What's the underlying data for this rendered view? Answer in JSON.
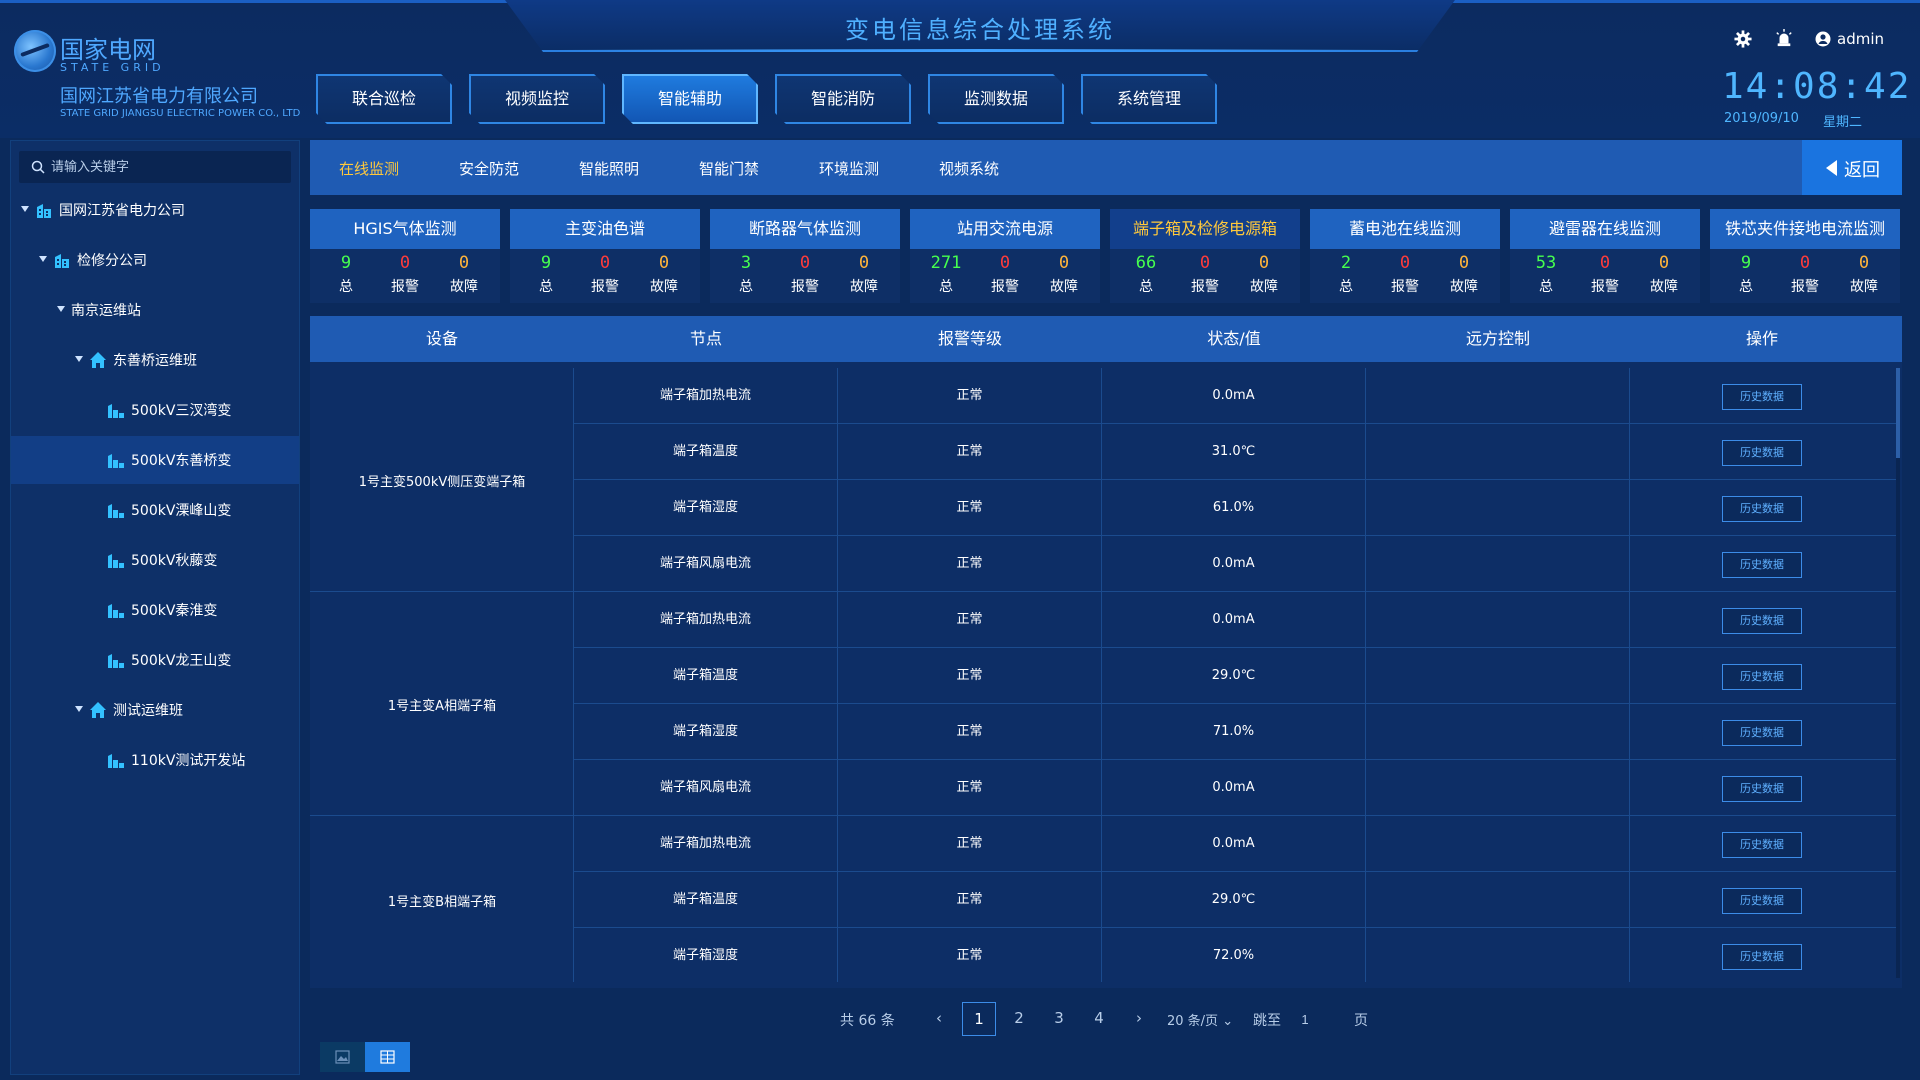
{
  "app": {
    "title": "变电信息综合处理系统"
  },
  "brand": {
    "name_cn": "国家电网",
    "name_en": "STATE GRID",
    "company_cn": "国网江苏省电力有限公司",
    "company_en": "STATE GRID JIANGSU ELECTRIC POWER CO., LTD"
  },
  "main_nav": [
    {
      "label": "联合巡检",
      "active": false
    },
    {
      "label": "视频监控",
      "active": false
    },
    {
      "label": "智能辅助",
      "active": true
    },
    {
      "label": "智能消防",
      "active": false
    },
    {
      "label": "监测数据",
      "active": false
    },
    {
      "label": "系统管理",
      "active": false
    }
  ],
  "user": {
    "name": "admin"
  },
  "clock": {
    "time": "14:08:42",
    "date": "2019/09/10",
    "weekday": "星期二"
  },
  "search": {
    "placeholder": "请输入关键字"
  },
  "tree": [
    {
      "label": "国网江苏省电力公司",
      "level": 0,
      "icon": "building-icon",
      "expanded": true
    },
    {
      "label": "检修分公司",
      "level": 1,
      "icon": "building-icon",
      "expanded": true
    },
    {
      "label": "南京运维站",
      "level": 2,
      "icon": "",
      "expanded": true
    },
    {
      "label": "东善桥运维班",
      "level": 3,
      "icon": "home-icon",
      "expanded": true
    },
    {
      "label": "500kV三汊湾变",
      "level": 4,
      "icon": "substation-icon"
    },
    {
      "label": "500kV东善桥变",
      "level": 4,
      "icon": "substation-icon",
      "selected": true
    },
    {
      "label": "500kV溧峰山变",
      "level": 4,
      "icon": "substation-icon"
    },
    {
      "label": "500kV秋藤变",
      "level": 4,
      "icon": "substation-icon"
    },
    {
      "label": "500kV秦淮变",
      "level": 4,
      "icon": "substation-icon"
    },
    {
      "label": "500kV龙王山变",
      "level": 4,
      "icon": "substation-icon"
    },
    {
      "label": "测试运维班",
      "level": 3,
      "icon": "home-icon",
      "expanded": true
    },
    {
      "label": "110kV测试开发站",
      "level": 4,
      "icon": "substation-icon"
    }
  ],
  "subnav": {
    "tabs": [
      {
        "label": "在线监测",
        "active": true
      },
      {
        "label": "安全防范"
      },
      {
        "label": "智能照明"
      },
      {
        "label": "智能门禁"
      },
      {
        "label": "环境监测"
      },
      {
        "label": "视频系统"
      }
    ],
    "back_label": "返回"
  },
  "stat_labels": {
    "total": "总",
    "alarm": "报警",
    "fault": "故障"
  },
  "cards": [
    {
      "title": "HGIS气体监测",
      "total": "9",
      "alarm": "0",
      "fault": "0"
    },
    {
      "title": "主变油色谱",
      "total": "9",
      "alarm": "0",
      "fault": "0"
    },
    {
      "title": "断路器气体监测",
      "total": "3",
      "alarm": "0",
      "fault": "0"
    },
    {
      "title": "站用交流电源",
      "total": "271",
      "alarm": "0",
      "fault": "0"
    },
    {
      "title": "端子箱及检修电源箱",
      "total": "66",
      "alarm": "0",
      "fault": "0",
      "active": true
    },
    {
      "title": "蓄电池在线监测",
      "total": "2",
      "alarm": "0",
      "fault": "0"
    },
    {
      "title": "避雷器在线监测",
      "total": "53",
      "alarm": "0",
      "fault": "0"
    },
    {
      "title": "铁芯夹件接地电流监测",
      "total": "9",
      "alarm": "0",
      "fault": "0"
    }
  ],
  "table": {
    "columns": [
      "设备",
      "节点",
      "报警等级",
      "状态/值",
      "远方控制",
      "操作"
    ],
    "groups": [
      {
        "device": "1号主变500kV侧压变端子箱",
        "rows": [
          {
            "node": "端子箱加热电流",
            "level": "正常",
            "value": "0.0mA",
            "remote": "",
            "action": "历史数据"
          },
          {
            "node": "端子箱温度",
            "level": "正常",
            "value": "31.0℃",
            "remote": "",
            "action": "历史数据"
          },
          {
            "node": "端子箱湿度",
            "level": "正常",
            "value": "61.0%",
            "remote": "",
            "action": "历史数据"
          },
          {
            "node": "端子箱风扇电流",
            "level": "正常",
            "value": "0.0mA",
            "remote": "",
            "action": "历史数据"
          }
        ]
      },
      {
        "device": "1号主变A相端子箱",
        "rows": [
          {
            "node": "端子箱加热电流",
            "level": "正常",
            "value": "0.0mA",
            "remote": "",
            "action": "历史数据"
          },
          {
            "node": "端子箱温度",
            "level": "正常",
            "value": "29.0℃",
            "remote": "",
            "action": "历史数据"
          },
          {
            "node": "端子箱湿度",
            "level": "正常",
            "value": "71.0%",
            "remote": "",
            "action": "历史数据"
          },
          {
            "node": "端子箱风扇电流",
            "level": "正常",
            "value": "0.0mA",
            "remote": "",
            "action": "历史数据"
          }
        ]
      },
      {
        "device": "1号主变B相端子箱",
        "rows": [
          {
            "node": "端子箱加热电流",
            "level": "正常",
            "value": "0.0mA",
            "remote": "",
            "action": "历史数据"
          },
          {
            "node": "端子箱温度",
            "level": "正常",
            "value": "29.0℃",
            "remote": "",
            "action": "历史数据"
          },
          {
            "node": "端子箱湿度",
            "level": "正常",
            "value": "72.0%",
            "remote": "",
            "action": "历史数据"
          }
        ]
      }
    ]
  },
  "pagination": {
    "total_text": "共 66 条",
    "prev": "‹",
    "pages": [
      "1",
      "2",
      "3",
      "4"
    ],
    "current": "1",
    "next": "›",
    "page_size": "20 条/页",
    "jump_label": "跳至",
    "jump_value": "1",
    "page_suffix": "页"
  },
  "colors": {
    "accent": "#1f5bb3",
    "active_text": "#ffc93c",
    "total": "#46ff4f",
    "alarm": "#ff3b3b",
    "fault": "#ffb43a"
  }
}
